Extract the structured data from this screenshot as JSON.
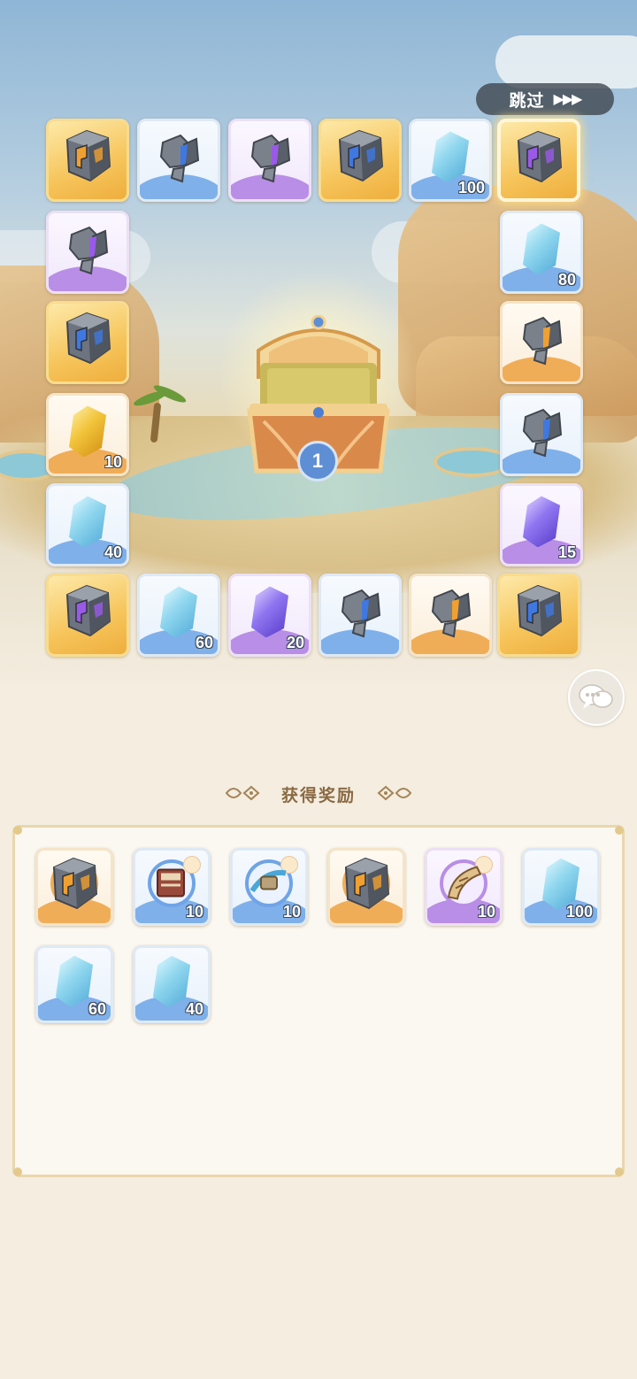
{
  "header": {
    "skip_label": "跳过",
    "skip_arrows": "▶▶▶"
  },
  "chest": {
    "count": "1"
  },
  "board": {
    "tiles": [
      {
        "rarity": "gold",
        "icon": "cube-orange-icon",
        "qty": ""
      },
      {
        "rarity": "blue",
        "icon": "shard-blue-icon",
        "qty": ""
      },
      {
        "rarity": "purple",
        "icon": "shard-purple-icon",
        "qty": ""
      },
      {
        "rarity": "gold",
        "icon": "cube-blue-icon",
        "qty": ""
      },
      {
        "rarity": "blue",
        "icon": "crystal-blue-icon",
        "qty": "100"
      },
      {
        "rarity": "gold",
        "icon": "cube-purple-icon",
        "qty": "",
        "selected": true
      },
      {
        "rarity": "purple",
        "icon": "shard-purple-icon",
        "qty": ""
      },
      {
        "rarity": "blue",
        "icon": "crystal-blue-icon",
        "qty": "80"
      },
      {
        "rarity": "gold",
        "icon": "cube-blue-icon",
        "qty": ""
      },
      {
        "rarity": "orange",
        "icon": "shard-orange-icon",
        "qty": ""
      },
      {
        "rarity": "orange",
        "icon": "crystal-gold-icon",
        "qty": "10"
      },
      {
        "rarity": "blue",
        "icon": "shard-blue-icon",
        "qty": ""
      },
      {
        "rarity": "blue",
        "icon": "crystal-blue-icon",
        "qty": "40"
      },
      {
        "rarity": "purple",
        "icon": "crystal-purple-icon",
        "qty": "15"
      },
      {
        "rarity": "gold",
        "icon": "cube-purple-icon",
        "qty": ""
      },
      {
        "rarity": "blue",
        "icon": "crystal-blue-icon",
        "qty": "60"
      },
      {
        "rarity": "purple",
        "icon": "crystal-purple-icon",
        "qty": "20"
      },
      {
        "rarity": "blue",
        "icon": "shard-blue-icon",
        "qty": ""
      },
      {
        "rarity": "orange",
        "icon": "shard-orange-icon",
        "qty": ""
      },
      {
        "rarity": "gold",
        "icon": "cube-blue-icon",
        "qty": ""
      }
    ]
  },
  "rewards": {
    "title": "获得奖励",
    "items": [
      {
        "rarity": "orange",
        "icon": "cube-orange-icon",
        "qty": ""
      },
      {
        "rarity": "blue",
        "icon": "book-icon",
        "qty": "10"
      },
      {
        "rarity": "blue",
        "icon": "scroll-icon",
        "qty": "10"
      },
      {
        "rarity": "orange",
        "icon": "cube-orange-icon",
        "qty": ""
      },
      {
        "rarity": "purple",
        "icon": "horn-icon",
        "qty": "10"
      },
      {
        "rarity": "blue",
        "icon": "crystal-blue-icon",
        "qty": "100"
      },
      {
        "rarity": "blue",
        "icon": "crystal-blue-icon",
        "qty": "60"
      },
      {
        "rarity": "blue",
        "icon": "crystal-blue-icon",
        "qty": "40"
      }
    ]
  },
  "colors": {
    "gold": "#f6c45a",
    "blue": "#7fb0ea",
    "purple": "#b98ee6",
    "orange": "#f0ad58",
    "title_text": "#8a6a43",
    "panel_border": "#e9d7ad"
  }
}
